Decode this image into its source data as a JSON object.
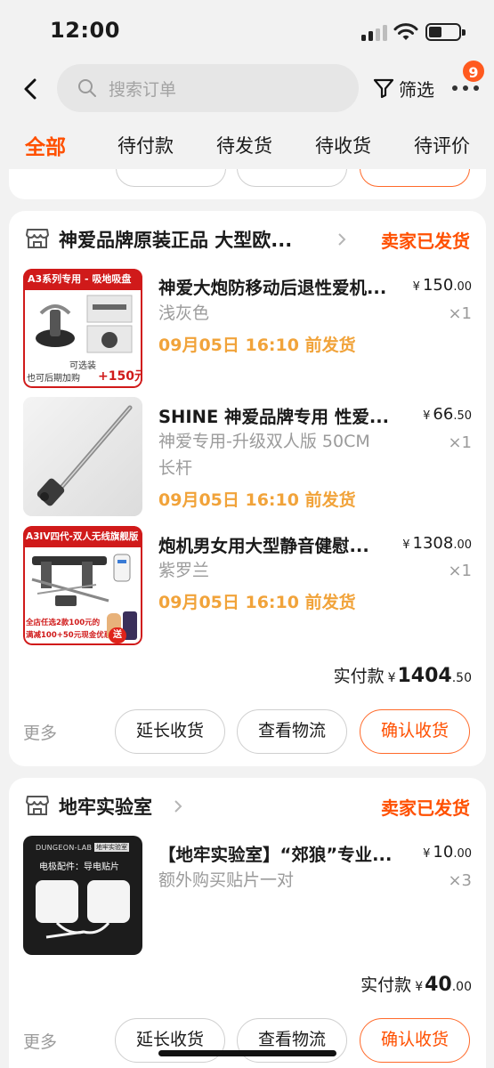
{
  "status_bar": {
    "time": "12:00"
  },
  "header": {
    "search_placeholder": "搜索订单",
    "filter_label": "筛选",
    "message_badge": "9"
  },
  "tabs": [
    {
      "label": "全部",
      "active": true
    },
    {
      "label": "待付款"
    },
    {
      "label": "待发货"
    },
    {
      "label": "待收货"
    },
    {
      "label": "待评价"
    }
  ],
  "orders": [
    {
      "shop_name": "神爱品牌原装正品 大型欧...",
      "status": "卖家已发货",
      "items": [
        {
          "title": "神爱大炮防移动后退性爱机...",
          "price_int": "150",
          "price_dec": ".00",
          "spec": "浅灰色",
          "qty": "×1",
          "ship": "09月05日 16:10 前发货",
          "thumb_banner": "A3系列专用 - 吸地吸盘",
          "thumb_caption_1": "可选装",
          "thumb_caption_2": "也可后期加购",
          "thumb_price": "+150元"
        },
        {
          "title": "SHINE 神爱品牌专用 性爱...",
          "price_int": "66",
          "price_dec": ".50",
          "spec_line1": "神爱专用-升级双人版 50CM",
          "spec_line2": "长杆",
          "qty": "×1",
          "ship": "09月05日 16:10 前发货"
        },
        {
          "title": "炮机男女用大型静音健慰...",
          "price_int": "1308",
          "price_dec": ".00",
          "spec": "紫罗兰",
          "qty": "×1",
          "ship": "09月05日 16:10 前发货",
          "thumb_banner": "A3IV四代-双人无线旗舰版",
          "thumb_caption_1": "全店任选2款100元的",
          "thumb_caption_2": "满减100+50元现金优惠",
          "thumb_tag": "送"
        }
      ],
      "total_label": "实付款",
      "total_int": "1404",
      "total_dec": ".50",
      "more": "更多",
      "actions": [
        "延长收货",
        "查看物流",
        "确认收货"
      ]
    },
    {
      "shop_name": "地牢实验室",
      "status": "卖家已发货",
      "items": [
        {
          "title": "【地牢实验室】“郊狼”专业...",
          "price_int": "10",
          "price_dec": ".00",
          "spec": "额外购买贴片一对",
          "qty": "×3",
          "thumb_brand": "DUNGEON-LAB",
          "thumb_brand_tag": "地牢实验室",
          "thumb_caption": "电极配件：导电贴片"
        }
      ],
      "total_label": "实付款",
      "total_int": "40",
      "total_dec": ".00",
      "more": "更多",
      "actions": [
        "延长收货",
        "查看物流",
        "确认收货"
      ]
    }
  ],
  "currency_symbol": "¥",
  "colors": {
    "accent": "#ff5000",
    "ship_text": "#f1a33a",
    "badge": "#ff5a1f"
  }
}
